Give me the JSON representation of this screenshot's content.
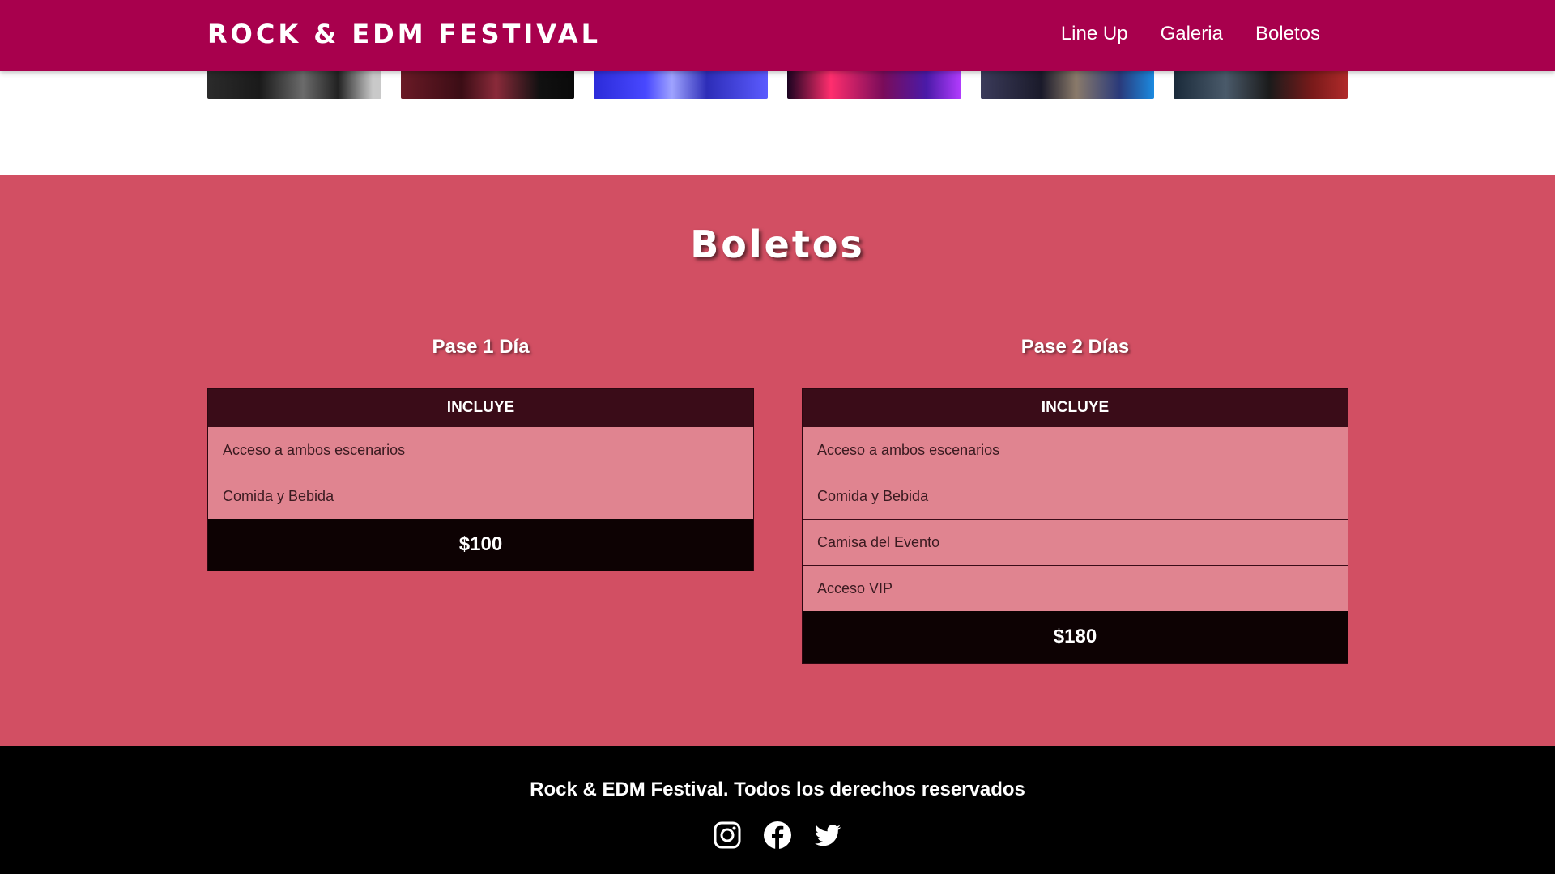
{
  "header": {
    "logo": "Rock & EDM Festival",
    "nav": [
      "Line Up",
      "Galeria",
      "Boletos"
    ]
  },
  "gallery": {
    "images": [
      "gallery-image-1",
      "gallery-image-2",
      "gallery-image-3",
      "gallery-image-4",
      "gallery-image-5",
      "gallery-image-6"
    ]
  },
  "tickets": {
    "title": "Boletos",
    "plans": [
      {
        "name": "Pase 1 Día",
        "header": "INCLUYE",
        "items": [
          "Acceso a ambos escenarios",
          "Comida y Bebida"
        ],
        "price": "$100"
      },
      {
        "name": "Pase 2 Días",
        "header": "INCLUYE",
        "items": [
          "Acceso a ambos escenarios",
          "Comida y Bebida",
          "Camisa del Evento",
          "Acceso VIP"
        ],
        "price": "$180"
      }
    ]
  },
  "footer": {
    "text": "Rock & EDM Festival. Todos los derechos reservados",
    "socials": [
      "instagram-icon",
      "facebook-icon",
      "twitter-icon"
    ]
  },
  "colors": {
    "header": "#a8004d",
    "section": "#d24f63",
    "table_head": "#3a0c18",
    "table_row": "#e08490",
    "price": "#0d0203",
    "footer": "#000000"
  }
}
